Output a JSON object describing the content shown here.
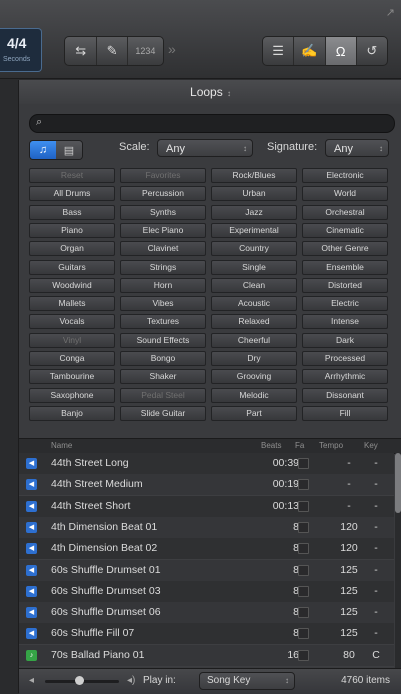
{
  "toolbar": {
    "signature": "4/4",
    "signature_sub": "Seconds",
    "cycle_icon": "cycle-icon",
    "tuner_icon": "tuner-icon",
    "count_in_label": "1234",
    "list_editors_icon": "list-icon",
    "note_pad_icon": "note-pad-icon",
    "loop_browser_icon": "loop-icon",
    "browsers_icon": "browsers-icon"
  },
  "panel": {
    "title": "Loops",
    "search_placeholder": "",
    "scale_label": "Scale:",
    "scale_value": "Any",
    "signature_label": "Signature:",
    "signature_value": "Any"
  },
  "keywords": [
    [
      "Reset",
      "Favorites",
      "Rock/Blues",
      "Electronic"
    ],
    [
      "All Drums",
      "Percussion",
      "Urban",
      "World"
    ],
    [
      "Bass",
      "Synths",
      "Jazz",
      "Orchestral"
    ],
    [
      "Piano",
      "Elec Piano",
      "Experimental",
      "Cinematic"
    ],
    [
      "Organ",
      "Clavinet",
      "Country",
      "Other Genre"
    ],
    [
      "Guitars",
      "Strings",
      "Single",
      "Ensemble"
    ],
    [
      "Woodwind",
      "Horn",
      "Clean",
      "Distorted"
    ],
    [
      "Mallets",
      "Vibes",
      "Acoustic",
      "Electric"
    ],
    [
      "Vocals",
      "Textures",
      "Relaxed",
      "Intense"
    ],
    [
      "Vinyl",
      "Sound Effects",
      "Cheerful",
      "Dark"
    ],
    [
      "Conga",
      "Bongo",
      "Dry",
      "Processed"
    ],
    [
      "Tambourine",
      "Shaker",
      "Grooving",
      "Arrhythmic"
    ],
    [
      "Saxophone",
      "Pedal Steel",
      "Melodic",
      "Dissonant"
    ],
    [
      "Banjo",
      "Slide Guitar",
      "Part",
      "Fill"
    ]
  ],
  "list": {
    "headers": {
      "name": "Name",
      "beats": "Beats",
      "fav": "Fa",
      "tempo": "Tempo",
      "key": "Key"
    },
    "rows": [
      {
        "name": "44th Street Long",
        "beats": "00:39",
        "tempo": "-",
        "key": "-"
      },
      {
        "name": "44th Street Medium",
        "beats": "00:19",
        "tempo": "-",
        "key": "-"
      },
      {
        "name": "44th Street Short",
        "beats": "00:13",
        "tempo": "-",
        "key": "-"
      },
      {
        "name": "4th Dimension Beat 01",
        "beats": "8",
        "tempo": "120",
        "key": "-"
      },
      {
        "name": "4th Dimension Beat 02",
        "beats": "8",
        "tempo": "120",
        "key": "-"
      },
      {
        "name": "60s Shuffle Drumset 01",
        "beats": "8",
        "tempo": "125",
        "key": "-"
      },
      {
        "name": "60s Shuffle Drumset 03",
        "beats": "8",
        "tempo": "125",
        "key": "-"
      },
      {
        "name": "60s Shuffle Drumset 06",
        "beats": "8",
        "tempo": "125",
        "key": "-"
      },
      {
        "name": "60s Shuffle Fill 07",
        "beats": "8",
        "tempo": "125",
        "key": "-"
      },
      {
        "name": "70s Ballad Piano 01",
        "beats": "16",
        "tempo": "80",
        "key": "C"
      }
    ]
  },
  "footer": {
    "play_in_label": "Play in:",
    "play_in_value": "Song Key",
    "item_count": "4760 items"
  }
}
